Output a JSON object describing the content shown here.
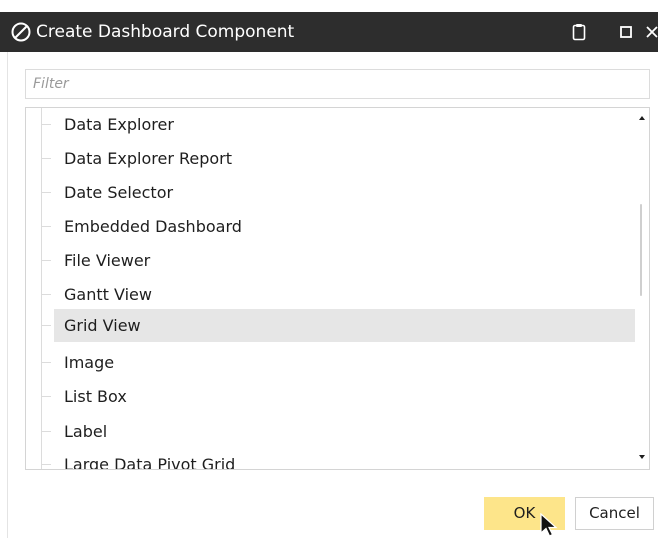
{
  "window": {
    "title": "Create Dashboard Component",
    "icons": {
      "logo": "no-entry-logo-icon",
      "clipboard": "clipboard-icon",
      "maximize": "maximize-icon",
      "close": "close-icon"
    },
    "title_bar_color": "#2d2d2d"
  },
  "filter": {
    "placeholder": "Filter",
    "value": ""
  },
  "list": {
    "items": [
      {
        "label": "Data Explorer",
        "selected": false
      },
      {
        "label": "Data Explorer Report",
        "selected": false
      },
      {
        "label": "Date Selector",
        "selected": false
      },
      {
        "label": "Embedded Dashboard",
        "selected": false
      },
      {
        "label": "File Viewer",
        "selected": false
      },
      {
        "label": "Gantt View",
        "selected": false
      },
      {
        "label": "Grid View",
        "selected": true
      },
      {
        "label": "Image",
        "selected": false
      },
      {
        "label": "List Box",
        "selected": false
      },
      {
        "label": "Label",
        "selected": false
      },
      {
        "label": "Large Data Pivot Grid",
        "selected": false
      }
    ],
    "selected_color": "#e6e6e6",
    "scroll_position": 0.42
  },
  "buttons": {
    "ok_label": "OK",
    "cancel_label": "Cancel",
    "ok_color": "#fde58a"
  }
}
